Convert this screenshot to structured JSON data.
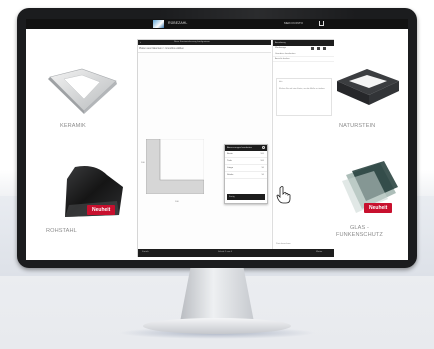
{
  "site": {
    "title": "RÜBEZAHL",
    "account": "MEIN KONTO",
    "cart_icon": "cart-icon"
  },
  "app": {
    "topbar_text": "Neue Kamineinfassung konfigurieren",
    "back_label": "‹",
    "breadcrumb": "Platten aus Naturstein > Grundriss wählen",
    "dim_y": "100",
    "dim_x": "100",
    "popup": {
      "title": "Abmessungen bearbeiten",
      "rows": [
        {
          "label": "Breite",
          "value": "100"
        },
        {
          "label": "Tiefe",
          "value": "100"
        },
        {
          "label": "Länge",
          "value": "50"
        },
        {
          "label": "Stärke",
          "value": "50"
        }
      ],
      "button": "Fertig"
    },
    "right_panel": {
      "head": "Anordnung",
      "tools_label": "Werkzeuge",
      "line1": "Grundriss bearbeiten",
      "line2": "Ansicht drehen",
      "box_title": "Info",
      "box_text": "Klicken Sie auf eine Kante, um die Maße zu ändern.",
      "bottom_text": "Preis berechnen"
    },
    "bottom_left": "Zurück",
    "bottom_mid": "Schritt 2 von 4",
    "bottom_right": "Weiter"
  },
  "products": {
    "left_top": "KERAMIK",
    "left_bottom": "ROHSTAHL",
    "right_top": "NATURSTEIN",
    "right_bottom": "GLAS -\nFUNKENSCHUTZ",
    "badge_new": "Neuheit"
  }
}
